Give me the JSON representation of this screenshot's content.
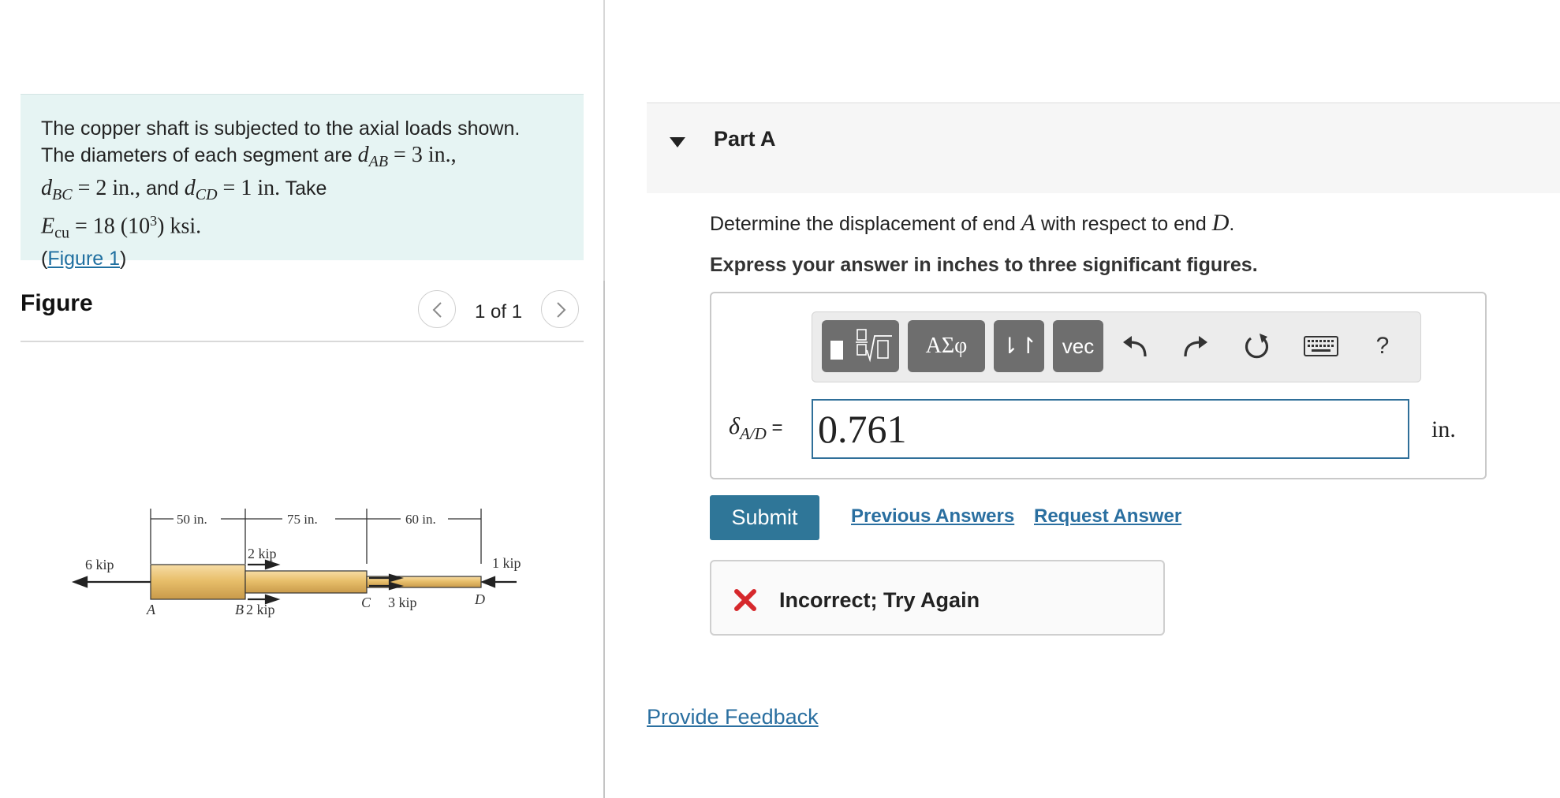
{
  "problem": {
    "line1": "The copper shaft is subjected to the axial loads shown.",
    "line2_text": "The diameters of each segment are ",
    "dAB_var": "d",
    "dAB_sub": "AB",
    "dAB_val": " = 3 in.,",
    "dBC_var": "d",
    "dBC_sub": "BC",
    "dBC_val": " = 2 in.,",
    "and_text": " and ",
    "dCD_var": "d",
    "dCD_sub": "CD",
    "dCD_val": " = 1 in.",
    "take_text": " Take",
    "E_var": "E",
    "E_sub": "cu",
    "E_val": " = 18 (10",
    "E_exp": "3",
    "E_unit": ")  ksi.",
    "figure_link_open": "(",
    "figure_link": "Figure 1",
    "figure_link_close": ")"
  },
  "figure": {
    "title": "Figure",
    "pager": "1 of 1",
    "diagram": {
      "dim_labels": [
        "50 in.",
        "75 in.",
        "60 in."
      ],
      "load_labels": [
        "6 kip",
        "2 kip",
        "1 kip",
        "3 kip",
        "2 kip"
      ],
      "point_labels": [
        "A",
        "B",
        "C",
        "D"
      ]
    }
  },
  "part": {
    "title": "Part A",
    "question_pre": "Determine the displacement of end ",
    "question_A": "A",
    "question_mid": " with respect to end ",
    "question_D": "D",
    "question_post": ".",
    "instruction": "Express your answer in inches to three significant figures."
  },
  "toolbar": {
    "greek": "ΑΣφ",
    "arrows": "⇂↾",
    "vec": "vec",
    "help": "?",
    "icons": [
      "templates-icon",
      "undo-icon",
      "redo-icon",
      "reset-icon",
      "keyboard-icon"
    ]
  },
  "answer": {
    "symbol": "δ",
    "subscript": "A/D",
    "equals": " =",
    "value": "0.761",
    "unit": "in."
  },
  "actions": {
    "submit": "Submit",
    "previous_answers": "Previous Answers",
    "request_answer": "Request Answer"
  },
  "feedback": {
    "status": "Incorrect; Try Again",
    "status_color": "#d6282c"
  },
  "footer": {
    "provide_feedback": "Provide Feedback"
  }
}
